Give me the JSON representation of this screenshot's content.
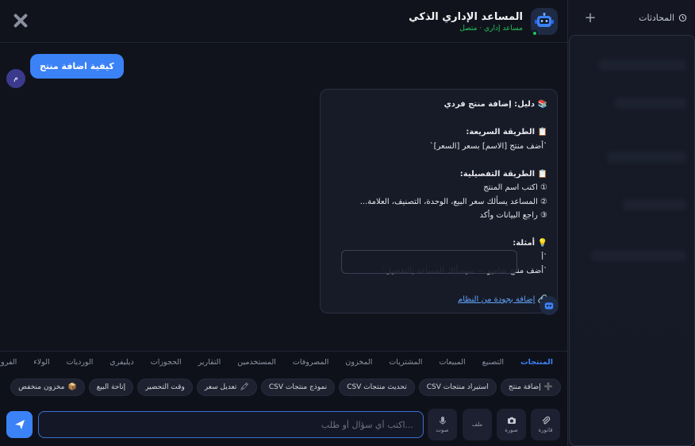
{
  "sidebar": {
    "title": "المحادثات",
    "new_label": "+"
  },
  "header": {
    "title": "المساعد الإداري الذكي",
    "status": "مساعد إداري · متصل"
  },
  "messages": {
    "user_avatar": "م",
    "user_text": "كيفية اضافة منتج",
    "bot": {
      "title": "📚 دليل: إضافة منتج فردي",
      "quick_heading": "📋 الطريقة السريعة:",
      "quick_cmd": "`أضف منتج [الاسم] بسعر [السعر]`",
      "detail_heading": "📋 الطريقة التفصيلية:",
      "step1": "① اكتب اسم المنتج",
      "step2": "② المساعد يسألك سعر البيع، الوحدة، التصنيف، العلامة...",
      "step3": "③ راجع البيانات وأكد",
      "examples_heading": "💡 أمثلة:",
      "example1": "`أ",
      "example2": "`أضف منتج شامبو — سيسألك المساعد بالتفصيل`",
      "link_icon": "🔗",
      "link_text": "إضافة بجودة من النظام"
    }
  },
  "tabs": [
    {
      "label": "المنتجات",
      "active": true
    },
    {
      "label": "التصنيع"
    },
    {
      "label": "المبيعات"
    },
    {
      "label": "المشتريات"
    },
    {
      "label": "المخزون"
    },
    {
      "label": "المصروفات"
    },
    {
      "label": "المستخدمين"
    },
    {
      "label": "التقارير"
    },
    {
      "label": "الحجوزات"
    },
    {
      "label": "ديليفري"
    },
    {
      "label": "الورديات"
    },
    {
      "label": "الولاء"
    },
    {
      "label": "الفروع"
    }
  ],
  "chips": [
    {
      "icon": "➕",
      "label": "إضافة منتج"
    },
    {
      "icon": "",
      "label": "استيراد منتجات CSV"
    },
    {
      "icon": "",
      "label": "تحديث منتجات CSV"
    },
    {
      "icon": "",
      "label": "نموذج منتجات CSV"
    },
    {
      "icon": "🖍",
      "label": "تعديل سعر"
    },
    {
      "icon": "",
      "label": "وقت التحضير"
    },
    {
      "icon": "",
      "label": "إتاحة البيع"
    },
    {
      "icon": "📦",
      "label": "مخزون منخفض"
    }
  ],
  "input": {
    "placeholder": "...اكتب أي سؤال أو طلب",
    "tools": {
      "invoice": "فاتورة",
      "image": "صورة",
      "file": "ملف",
      "voice": "صوت"
    }
  },
  "colors": {
    "accent": "#3b82f6",
    "online": "#22c55e",
    "background": "#11131c"
  }
}
